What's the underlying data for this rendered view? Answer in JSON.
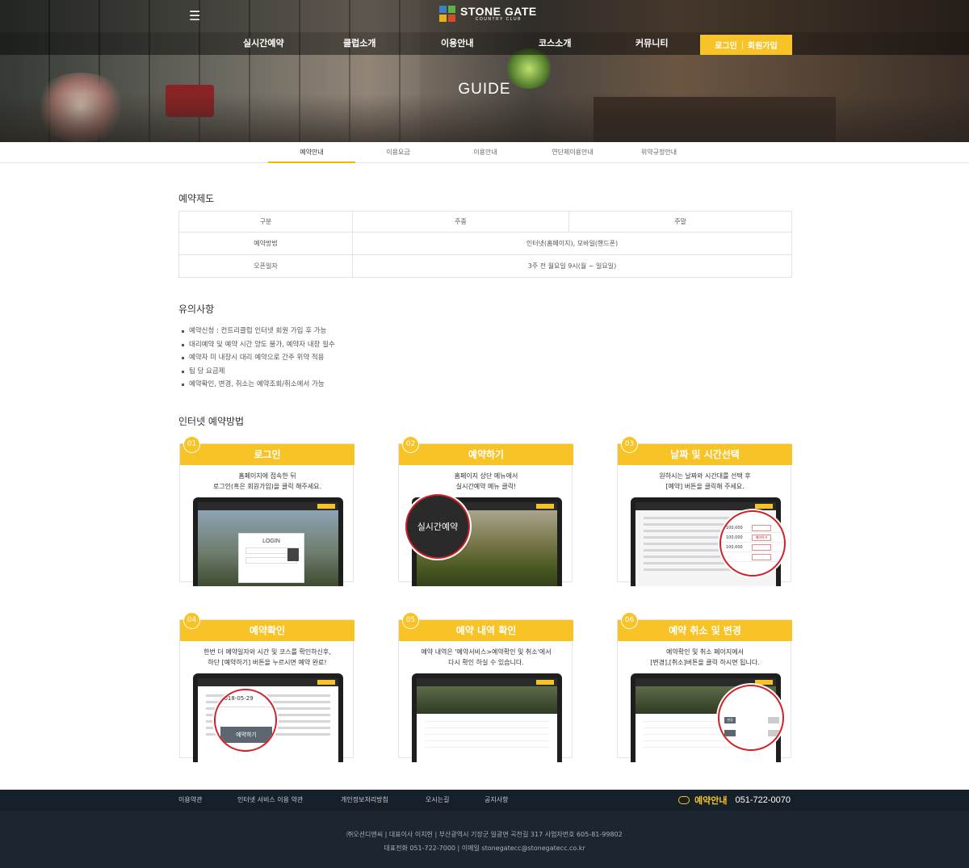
{
  "header": {
    "logo_main": "STONE GATE",
    "logo_sub": "COUNTRY CLUB",
    "nav": [
      "실시간예약",
      "클럽소개",
      "이용안내",
      "코스소개",
      "커뮤니티"
    ],
    "login_label": "로그인",
    "join_label": "회원가입",
    "hero_title": "GUIDE",
    "menu_icon": "menu-icon"
  },
  "tabs": {
    "items": [
      "예약안내",
      "이용요금",
      "이용안내",
      "연단체이용안내",
      "위약규정안내"
    ],
    "active": "예약안내"
  },
  "reservation": {
    "title": "예약제도",
    "headers": [
      "구분",
      "주중",
      "주말"
    ],
    "rows": [
      {
        "label": "예약방법",
        "value": "인터넷(홈페이지), 모바일(핸드폰)"
      },
      {
        "label": "오픈일자",
        "value": "3주 전 월요일 9시(월 ~ 일요일)"
      }
    ]
  },
  "notes": {
    "title": "유의사항",
    "items": [
      "예약신청 : 컨트리클럽 인터넷 회원 가입 후 가능",
      "대리예약 및 예약 시간 양도 불가, 예약자 내장 필수",
      "예약자 미 내장시 대리 예약으로 간주 위약 적용",
      "팀 당 요금제",
      "예약확인, 변경, 취소는 예약조회/취소에서 가능"
    ]
  },
  "steps": {
    "title": "인터넷 예약방법",
    "items": [
      {
        "num": "01",
        "title": "로그인",
        "line1": "홈페이지에 접속한 뒤",
        "line2": "로그인(혹은 회원가입)을 클릭 해주세요.",
        "screen_label": "LOGIN"
      },
      {
        "num": "02",
        "title": "예약하기",
        "line1": "홈페이지 상단 메뉴에서",
        "line2": "실시간예약 메뉴 클릭!",
        "screen_label": "실시간예약"
      },
      {
        "num": "03",
        "title": "날짜 및 시간선택",
        "line1": "원하시는 날짜와 시간대를 선택 후",
        "line2": "[예약] 버튼을 클릭해 주세요.",
        "screen_label": "예약하기"
      },
      {
        "num": "04",
        "title": "예약확인",
        "line1": "한번 더 예약일자와 시간 및 코스를 확인하신후,",
        "line2": "하단 [예약하기] 버튼을 누르시면 예약 완료!",
        "screen_label": "예약하기",
        "screen_date": "2018-05-29"
      },
      {
        "num": "05",
        "title": "예약 내역 확인",
        "line1": "예약 내역은 '예약서비스>예약확인 및 취소'에서",
        "line2": "다시 확인 하실 수 있습니다.",
        "screen_label": ""
      },
      {
        "num": "06",
        "title": "예약 취소 및 변경",
        "line1": "예약확인 및 취소 페이지에서",
        "line2": "[변경],[취소]버튼을 클릭 하시면 됩니다.",
        "screen_label": "변경"
      }
    ]
  },
  "footer": {
    "links": [
      "이용약관",
      "인터넷 서비스 이용 약관",
      "개인정보처리방침",
      "오시는길",
      "공지사항"
    ],
    "reserve_label": "예약안내",
    "reserve_phone": "051-722-0070",
    "info_line1": "㈜오션디앤씨 | 대표이사 이치헌 | 부산광역시 기장군 일광면 곡천길 317 사업자번호 605-81-99802",
    "info_line2": "대표전화 051-722-7000 | 이메일 stonegatecc@stonegatecc.co.kr"
  },
  "colors": {
    "accent": "#f7c327",
    "footer": "#1b2630",
    "magnifier": "#d02128"
  }
}
